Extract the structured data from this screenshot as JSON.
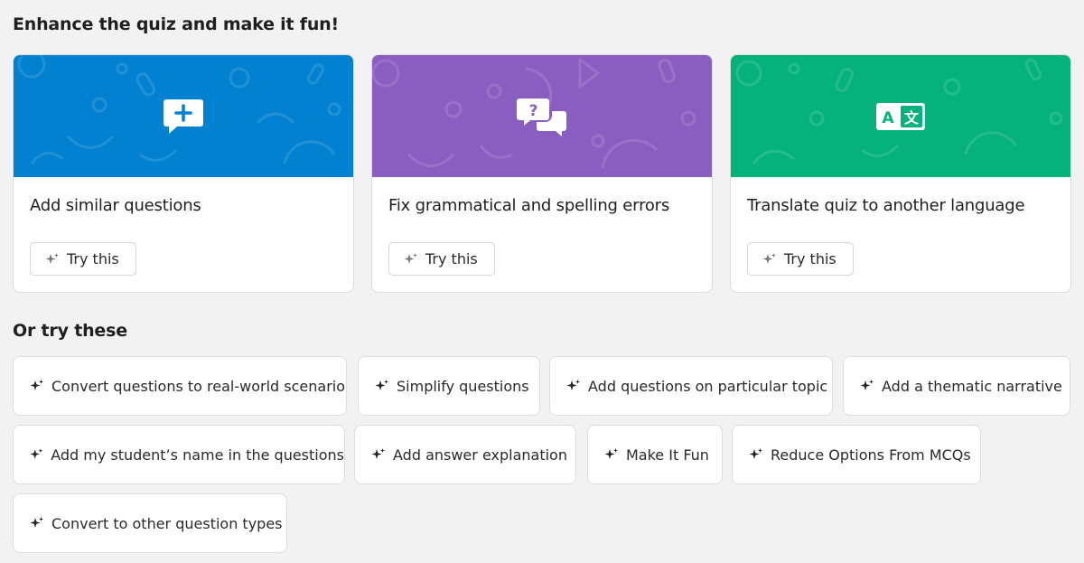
{
  "section_title": "Enhance the quiz and make it fun!",
  "cards": [
    {
      "title": "Add similar questions",
      "button": "Try this",
      "color": "#0181d0",
      "icon": "add-comment-icon"
    },
    {
      "title": "Fix grammatical and spelling errors",
      "button": "Try this",
      "color": "#8a5ec0",
      "icon": "question-chat-icon"
    },
    {
      "title": "Translate quiz to another language",
      "button": "Try this",
      "color": "#05b27a",
      "icon": "translate-icon"
    }
  ],
  "secondary_title": "Or try these",
  "chips": [
    "Convert questions to real-world scenario",
    "Simplify questions",
    "Add questions on particular topic",
    "Add a thematic narrative",
    "Add my student’s name in the questions",
    "Add answer explanation",
    "Make It Fun",
    "Reduce Options From MCQs",
    "Convert to other question types"
  ],
  "colors": {
    "page_bg": "#f2f2f2",
    "text": "#1f1f1f",
    "border": "#dcdcdc"
  }
}
